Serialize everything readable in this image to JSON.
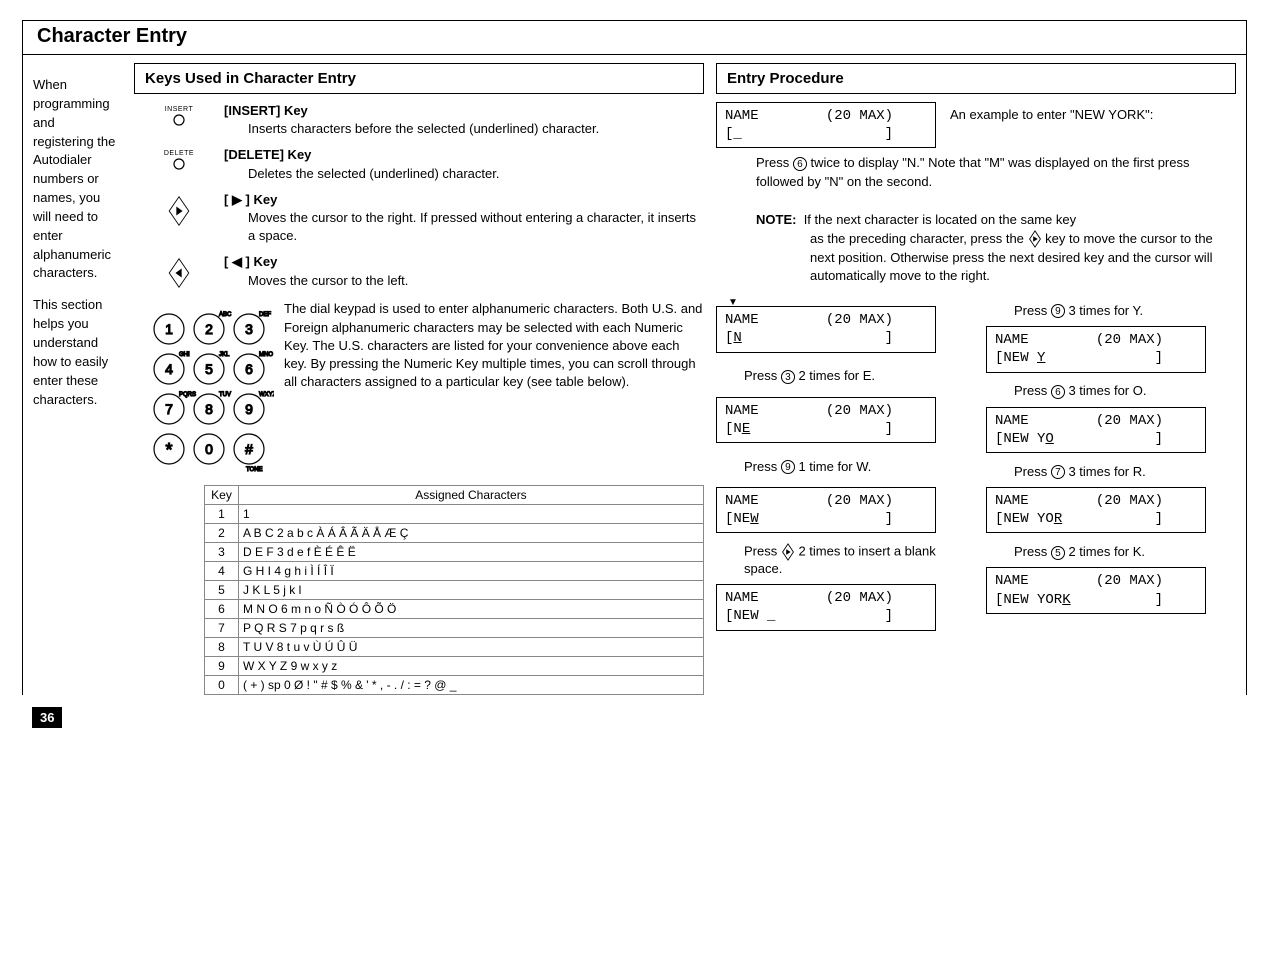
{
  "page_number": "36",
  "title": "Character Entry",
  "intro_p1": "When programming and registering the Autodialer numbers or names, you will need to enter alphanumeric characters.",
  "intro_p2": "This section helps you understand how to easily enter these characters.",
  "keys_panel_title": "Keys Used in Character Entry",
  "entry_panel_title": "Entry Procedure",
  "insert_label": "INSERT",
  "insert_key_name": "[INSERT] Key",
  "insert_desc": "Inserts characters before the selected (underlined) character.",
  "delete_label": "DELETE",
  "delete_key_name": "[DELETE] Key",
  "delete_desc": "Deletes the selected (underlined) character.",
  "right_key_name": "[ ▶ ] Key",
  "right_desc": "Moves the cursor to the right. If pressed without entering a character, it inserts a space.",
  "left_key_name": "[ ◀ ] Key",
  "left_desc": "Moves the cursor to the left.",
  "keypad_desc": "The dial keypad is used to enter alphanumeric characters. Both U.S. and Foreign alphanumeric characters may be selected with each Numeric Key. The U.S. characters are listed for your convenience above each key. By pressing the Numeric Key multiple times, you can scroll through all characters assigned to a particular key (see table below).",
  "table_header_key": "Key",
  "table_header_assigned": "Assigned Characters",
  "char_rows": [
    {
      "k": "1",
      "v": "1"
    },
    {
      "k": "2",
      "v": "A B C 2 a b c À Á Â Ã Ä Å Æ Ç"
    },
    {
      "k": "3",
      "v": "D E F 3 d e f È É Ê Ë"
    },
    {
      "k": "4",
      "v": "G H I 4 g h i Ì Í Î Ï"
    },
    {
      "k": "5",
      "v": "J K L 5 j k l"
    },
    {
      "k": "6",
      "v": "M N O 6 m n o Ñ Ò Ó Ô Õ Ö"
    },
    {
      "k": "7",
      "v": "P Q R S 7 p q r s ß"
    },
    {
      "k": "8",
      "v": "T U V 8 t u v Ù Ú Û Ü"
    },
    {
      "k": "9",
      "v": "W X Y Z 9 w x y z"
    },
    {
      "k": "0",
      "v": "( + ) sp 0 Ø ! \" # $ % & ' * , - . / : = ? @ _"
    }
  ],
  "ex_caption": "An example to enter \"NEW YORK\":",
  "ex_lcd0_l1": "NAME        (20 MAX)",
  "ex_lcd0_l2": "[_                 ]",
  "ex_press6": "twice to display \"N.\" Note that \"M\" was displayed on the first press followed by \"N\" on the second.",
  "ex_press_lead": "Press",
  "ex_note_label": "NOTE:",
  "ex_note_text": "If the next character is located on the same key",
  "ex_note_cont": "as the preceding character, press the",
  "ex_note_cont2": "key to move the cursor to the next position. Otherwise press the next desired key and the cursor will automatically move to the right.",
  "lcdN_l1": "NAME        (20 MAX)",
  "lcdN_l2_pre": "[",
  "lcdN_l2_u": "N",
  "lcdN_l2_post": "                 ]",
  "lcdNE_l2_pre": "[N",
  "lcdNE_l2_u": "E",
  "lcdNE_l2_post": "                ]",
  "lcdNEW_l2_pre": "[NE",
  "lcdNEW_l2_u": "W",
  "lcdNEW_l2_post": "               ]",
  "lcdNEWsp_l2_pre": "[NEW _             ]",
  "lcdNEWY_l2_pre": "[NEW ",
  "lcdNEWY_l2_u": "Y",
  "lcdNEWY_l2_post": "             ]",
  "lcdNEWYO_l2_pre": "[NEW Y",
  "lcdNEWYO_l2_u": "O",
  "lcdNEWYO_l2_post": "            ]",
  "lcdNEWYOR_l2_pre": "[NEW YO",
  "lcdNEWYOR_l2_u": "R",
  "lcdNEWYOR_l2_post": "           ]",
  "lcdNEWYORK_l2_pre": "[NEW YOR",
  "lcdNEWYORK_l2_u": "K",
  "lcdNEWYORK_l2_post": "          ]",
  "stepE_pre": "Press ",
  "stepE_key": "3",
  "stepE_post": " 2 times for E.",
  "stepW_pre": "Press ",
  "stepW_key": "9",
  "stepW_post": " 1 time for W.",
  "stepSp_pre": "Press ",
  "stepSp_post": " 2 times to insert a blank space.",
  "stepY_pre": "Press ",
  "stepY_key": "9",
  "stepY_post": " 3 times for Y.",
  "stepO_pre": "Press ",
  "stepO_key": "6",
  "stepO_post": " 3 times for O.",
  "stepR_pre": "Press ",
  "stepR_key": "7",
  "stepR_post": " 3 times for R.",
  "stepK_pre": "Press ",
  "stepK_key": "5",
  "stepK_post": " 2 times for K."
}
